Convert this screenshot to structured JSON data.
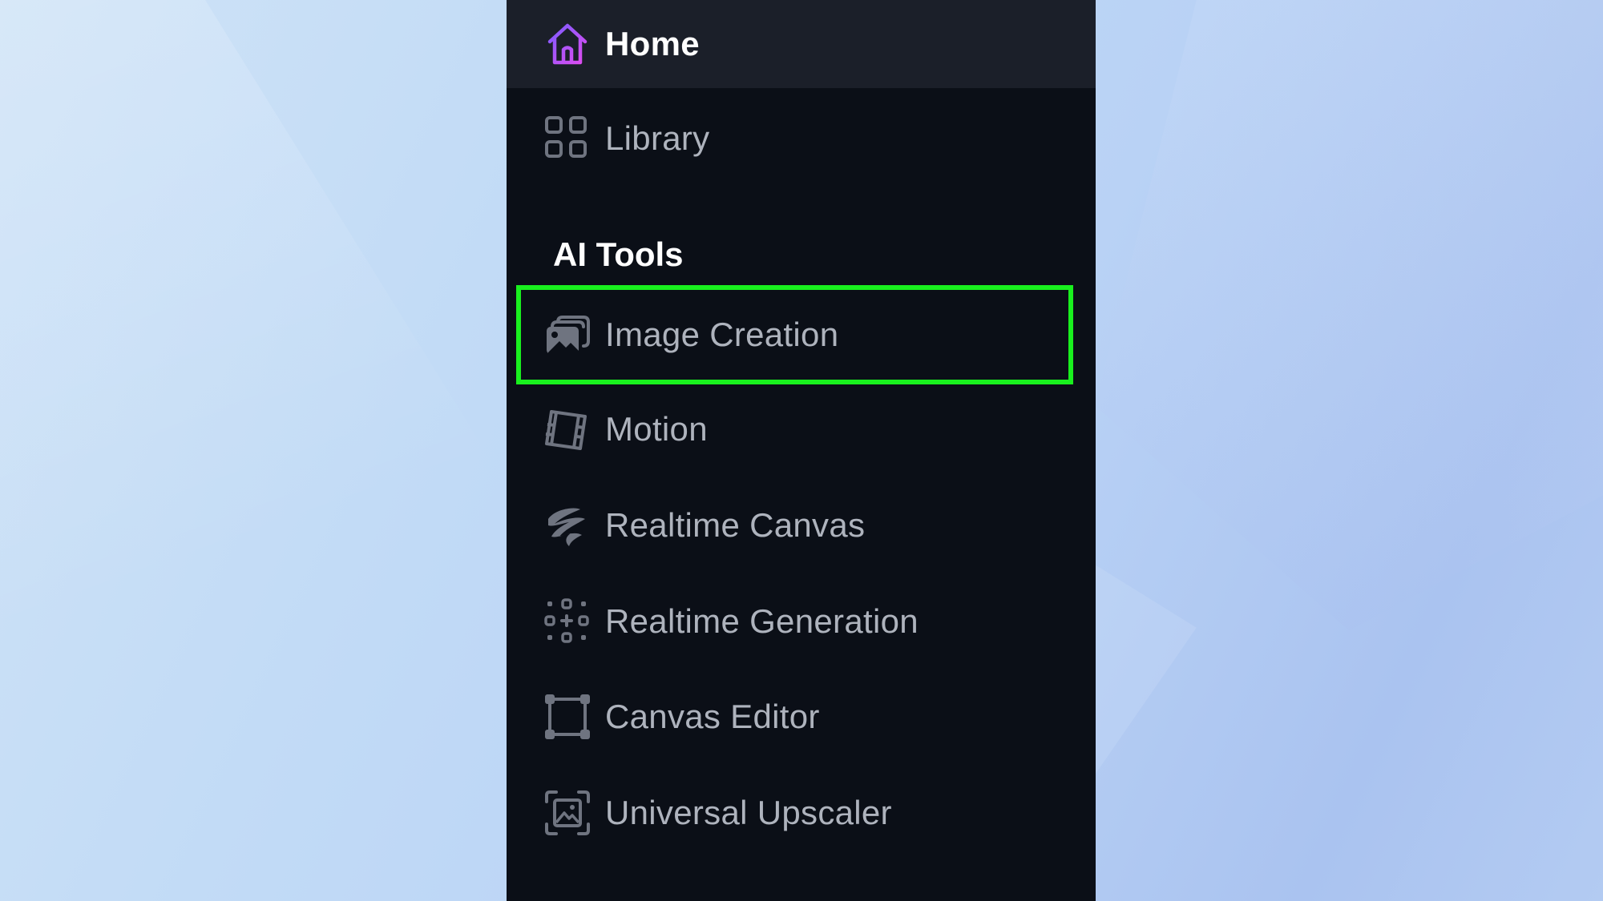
{
  "sidebar": {
    "items": [
      {
        "label": "Home",
        "icon": "home-icon",
        "active": true
      },
      {
        "label": "Library",
        "icon": "grid-icon"
      }
    ],
    "section_title": "AI Tools",
    "tools": [
      {
        "label": "Image Creation",
        "icon": "image-stack-icon",
        "highlighted": true
      },
      {
        "label": "Motion",
        "icon": "film-icon"
      },
      {
        "label": "Realtime Canvas",
        "icon": "brush-stroke-icon"
      },
      {
        "label": "Realtime Generation",
        "icon": "dots-grid-icon"
      },
      {
        "label": "Canvas Editor",
        "icon": "frame-icon"
      },
      {
        "label": "Universal Upscaler",
        "icon": "upscale-icon"
      }
    ]
  },
  "colors": {
    "sidebar_bg": "#0b0f17",
    "home_row_bg": "#1b1f29",
    "highlight": "#19f01e",
    "home_icon_gradient": [
      "#7b5cff",
      "#e04cf0"
    ],
    "muted_text": "#aeb3bd"
  }
}
